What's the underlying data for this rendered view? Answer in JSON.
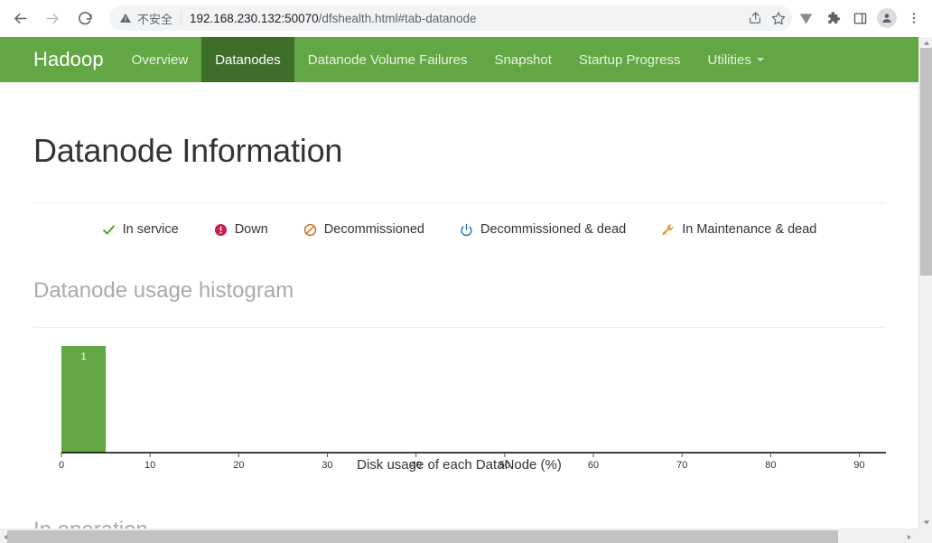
{
  "browser": {
    "back_icon": "back-arrow-icon",
    "forward_icon": "forward-arrow-icon",
    "reload_icon": "reload-icon",
    "security_label": "不安全",
    "url_host": "192.168.230.132:50070",
    "url_path": "/dfshealth.html#tab-datanode",
    "url_full": "192.168.230.132:50070/dfshealth.html#tab-datanode",
    "toolbar_icons": [
      "share-icon",
      "bookmark-star-icon",
      "vimeo-extension-icon",
      "extensions-puzzle-icon",
      "side-panel-icon",
      "profile-avatar-icon",
      "browser-menu-icon"
    ]
  },
  "navbar": {
    "brand": "Hadoop",
    "items": [
      {
        "label": "Overview",
        "active": false,
        "caret": false
      },
      {
        "label": "Datanodes",
        "active": true,
        "caret": false
      },
      {
        "label": "Datanode Volume Failures",
        "active": false,
        "caret": false
      },
      {
        "label": "Snapshot",
        "active": false,
        "caret": false
      },
      {
        "label": "Startup Progress",
        "active": false,
        "caret": false
      },
      {
        "label": "Utilities",
        "active": false,
        "caret": true
      }
    ],
    "bg_color": "#63a744",
    "active_bg_color": "#3f6e2a"
  },
  "page": {
    "title": "Datanode Information",
    "histogram_heading": "Datanode usage histogram",
    "in_operation_heading": "In operation"
  },
  "legend": [
    {
      "label": "In service",
      "icon": "check-icon",
      "color": "#4f9e28"
    },
    {
      "label": "Down",
      "icon": "alert-circle-icon",
      "color": "#c9204f"
    },
    {
      "label": "Decommissioned",
      "icon": "ban-circle-icon",
      "color": "#d2691e"
    },
    {
      "label": "Decommissioned & dead",
      "icon": "power-off-icon",
      "color": "#1c6fc4"
    },
    {
      "label": "In Maintenance & dead",
      "icon": "wrench-icon",
      "color": "#f0932b"
    }
  ],
  "chart_data": {
    "type": "bar",
    "title": "Datanode usage histogram",
    "xlabel": "Disk usage of each DataNode (%)",
    "ylabel": "",
    "categories": [
      "0-5"
    ],
    "values": [
      1
    ],
    "bar_labels": [
      "1"
    ],
    "bar_color": "#63a744",
    "bar_label_color": "#ffffff",
    "bin_start": [
      0
    ],
    "bin_end": [
      5
    ],
    "xlim": [
      0,
      93
    ],
    "ylim": [
      0,
      1
    ],
    "xticks": [
      0,
      10,
      20,
      30,
      40,
      50,
      60,
      70,
      80,
      90
    ],
    "xtick_labels": [
      "0",
      "10",
      "20",
      "30",
      "40",
      "50",
      "60",
      "70",
      "80",
      "90"
    ],
    "grid": false,
    "legend_position": "none"
  },
  "scrollbars": {
    "vertical_thumb_label": "vertical-scrollbar-thumb",
    "horizontal_thumb_label": "horizontal-scrollbar-thumb"
  }
}
